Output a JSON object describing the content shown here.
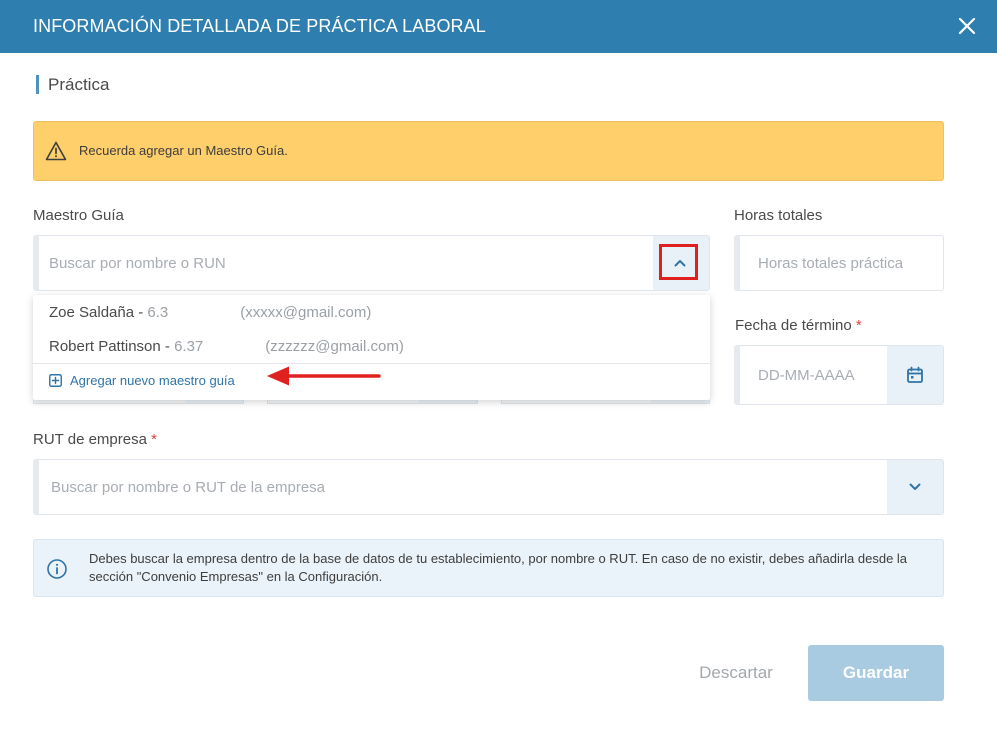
{
  "header": {
    "title": "INFORMACIÓN DETALLADA DE PRÁCTICA LABORAL",
    "close_icon": "close-icon"
  },
  "section": {
    "title": "Práctica"
  },
  "alert": {
    "text": "Recuerda agregar un Maestro Guía.",
    "icon": "warning-icon",
    "color": "#fecf6b"
  },
  "maestro_guia": {
    "label": "Maestro Guía",
    "placeholder": "Buscar por nombre o RUN",
    "toggle_icon": "chevron-up-icon",
    "options": [
      {
        "name": "Zoe Saldaña - ",
        "run": "6.3",
        "email": "(xxxxx@gmail.com)"
      },
      {
        "name": "Robert Pattinson - ",
        "run": "6.37",
        "email": "(zzzzzz@gmail.com)"
      }
    ],
    "add_new_label": "Agregar nuevo maestro guía",
    "add_icon": "plus-square-icon"
  },
  "horas_totales": {
    "label": "Horas totales",
    "placeholder": "Horas totales práctica"
  },
  "fecha_termino": {
    "label": "Fecha de término",
    "required_mark": "*",
    "placeholder": "DD-MM-AAAA",
    "icon": "calendar-icon"
  },
  "rut_empresa": {
    "label": "RUT de empresa",
    "required_mark": "*",
    "placeholder": "Buscar por nombre o RUT de la empresa",
    "toggle_icon": "chevron-down-icon"
  },
  "info": {
    "icon": "info-icon",
    "text": "Debes buscar la empresa dentro de la base de datos de tu establecimiento, por nombre o RUT. En caso de no existir, debes añadirla desde la sección \"Convenio Empresas\" en la Configuración."
  },
  "footer": {
    "discard_label": "Descartar",
    "save_label": "Guardar"
  },
  "colors": {
    "header": "#2e7fb0",
    "accent": "#2f74a6",
    "annotation": "#e0201f",
    "save_disabled": "#a9cbe1"
  }
}
